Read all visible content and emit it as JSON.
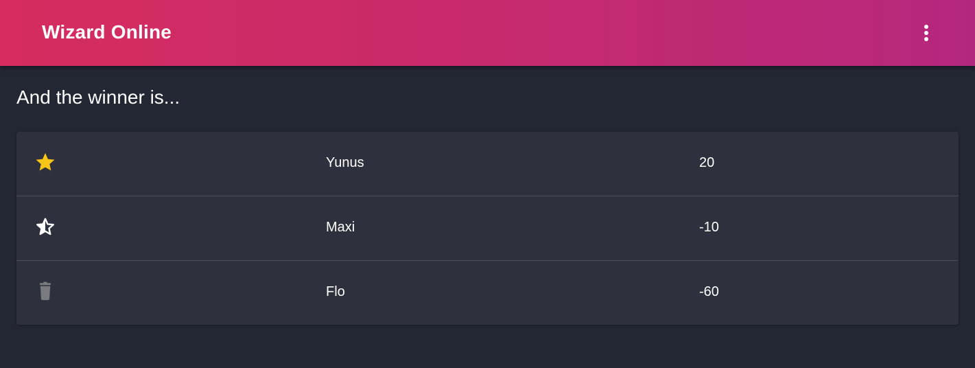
{
  "appbar": {
    "title": "Wizard Online",
    "menu_icon": "more-vertical-icon"
  },
  "main": {
    "heading": "And the winner is..."
  },
  "results": [
    {
      "icon": "star-icon",
      "icon_color": "#f5c518",
      "name": "Yunus",
      "score": "20"
    },
    {
      "icon": "star-half-icon",
      "icon_color": "#ffffff",
      "name": "Maxi",
      "score": "-10"
    },
    {
      "icon": "trash-icon",
      "icon_color": "#7a7b80",
      "name": "Flo",
      "score": "-60"
    }
  ],
  "colors": {
    "appbar_start": "#d62c5f",
    "appbar_end": "#b5277e",
    "background": "#232633",
    "card": "#2e303d"
  }
}
